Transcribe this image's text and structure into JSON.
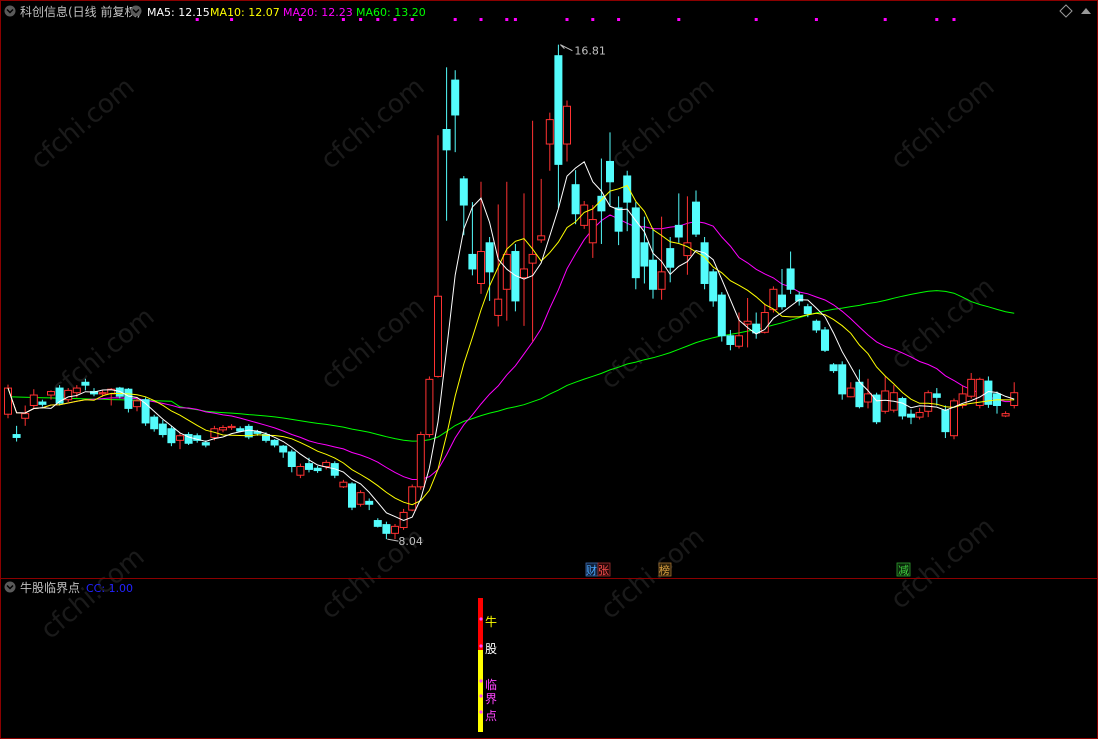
{
  "main_panel": {
    "title": "科创信息(日线 前复权)",
    "ma_labels": [
      {
        "text": "MA5: 12.15",
        "color": "#ffffff"
      },
      {
        "text": "MA10: 12.07",
        "color": "#ffff00"
      },
      {
        "text": "MA20: 12.23",
        "color": "#ff00ff"
      },
      {
        "text": "MA60: 13.20",
        "color": "#00ff00"
      }
    ],
    "high_marker": "16.81",
    "low_marker": "8.04",
    "event_tags": [
      {
        "text": "财",
        "color": "#4aa8ff"
      },
      {
        "text": "张",
        "color": "#ff5050"
      },
      {
        "text": "榜",
        "color": "#d8a040"
      },
      {
        "text": "减",
        "color": "#40d040"
      }
    ]
  },
  "indicator_panel": {
    "title": "牛股临界点",
    "value_text": "CC: 1.00",
    "signal_chars": [
      "牛",
      "股",
      "临",
      "界",
      "点"
    ]
  },
  "watermark": "cfchi.com",
  "colors": {
    "up": "#ff3232",
    "down": "#54fcfc",
    "ma5": "#ffffff",
    "ma10": "#ffff00",
    "ma20": "#ff00ff",
    "ma60": "#00ff00",
    "grid": "#8b0000"
  },
  "chart_data": {
    "type": "candlestick",
    "title": "科创信息(日线 前复权)",
    "ylim": [
      7.7,
      17.2
    ],
    "note_high": 16.81,
    "note_low": 8.04,
    "candles": [
      [
        10.45,
        10.9,
        10.38,
        10.96
      ],
      [
        10.1,
        10.05,
        9.98,
        10.25
      ],
      [
        10.38,
        10.46,
        10.25,
        10.6
      ],
      [
        10.6,
        10.78,
        10.55,
        10.88
      ],
      [
        10.66,
        10.62,
        10.58,
        10.7
      ],
      [
        10.78,
        10.84,
        10.7,
        10.86
      ],
      [
        10.9,
        10.64,
        10.6,
        10.95
      ],
      [
        10.7,
        10.86,
        10.66,
        10.9
      ],
      [
        10.82,
        10.9,
        10.74,
        10.95
      ],
      [
        11.0,
        10.95,
        10.86,
        11.06
      ],
      [
        10.84,
        10.8,
        10.76,
        10.9
      ],
      [
        10.8,
        10.82,
        10.75,
        10.86
      ],
      [
        10.8,
        10.88,
        10.6,
        10.9
      ],
      [
        10.9,
        10.76,
        10.72,
        10.92
      ],
      [
        10.88,
        10.55,
        10.48,
        10.9
      ],
      [
        10.58,
        10.68,
        10.5,
        10.74
      ],
      [
        10.7,
        10.3,
        10.25,
        10.74
      ],
      [
        10.4,
        10.2,
        10.15,
        10.44
      ],
      [
        10.28,
        10.1,
        10.05,
        10.35
      ],
      [
        10.2,
        9.96,
        9.9,
        10.25
      ],
      [
        10.0,
        10.08,
        9.85,
        10.12
      ],
      [
        10.1,
        9.95,
        9.92,
        10.14
      ],
      [
        10.08,
        10.0,
        9.96,
        10.12
      ],
      [
        9.96,
        9.92,
        9.88,
        10.0
      ],
      [
        10.05,
        10.2,
        10.0,
        10.25
      ],
      [
        10.18,
        10.22,
        10.14,
        10.26
      ],
      [
        10.22,
        10.24,
        10.18,
        10.28
      ],
      [
        10.2,
        10.16,
        10.14,
        10.24
      ],
      [
        10.24,
        10.06,
        10.02,
        10.28
      ],
      [
        10.15,
        10.12,
        10.08,
        10.18
      ],
      [
        10.1,
        10.0,
        9.96,
        10.14
      ],
      [
        10.0,
        9.92,
        9.88,
        10.02
      ],
      [
        9.9,
        9.8,
        9.7,
        9.92
      ],
      [
        9.8,
        9.55,
        9.45,
        9.84
      ],
      [
        9.4,
        9.55,
        9.35,
        9.6
      ],
      [
        9.6,
        9.5,
        9.45,
        9.7
      ],
      [
        9.52,
        9.48,
        9.44,
        9.56
      ],
      [
        9.55,
        9.62,
        9.5,
        9.66
      ],
      [
        9.6,
        9.4,
        9.35,
        9.64
      ],
      [
        9.2,
        9.28,
        9.18,
        9.32
      ],
      [
        9.25,
        8.85,
        8.8,
        9.28
      ],
      [
        8.9,
        9.1,
        8.86,
        9.14
      ],
      [
        8.95,
        8.9,
        8.8,
        9.0
      ],
      [
        8.62,
        8.52,
        8.5,
        8.66
      ],
      [
        8.55,
        8.4,
        8.3,
        8.6
      ],
      [
        8.4,
        8.52,
        8.3,
        8.56
      ],
      [
        8.5,
        8.76,
        8.46,
        8.82
      ],
      [
        8.8,
        9.2,
        8.78,
        9.24
      ],
      [
        9.2,
        10.1,
        9.15,
        10.15
      ],
      [
        10.1,
        11.05,
        10.05,
        11.1
      ],
      [
        11.1,
        12.48,
        11.08,
        15.25
      ],
      [
        15.35,
        15.0,
        13.78,
        16.42
      ],
      [
        16.2,
        15.6,
        14.96,
        16.37
      ],
      [
        14.5,
        14.05,
        13.53,
        14.55
      ],
      [
        13.2,
        12.95,
        12.84,
        14.1
      ],
      [
        12.7,
        13.25,
        12.52,
        14.45
      ],
      [
        13.4,
        12.9,
        12.4,
        13.5
      ],
      [
        12.15,
        12.43,
        11.96,
        14.06
      ],
      [
        12.6,
        13.2,
        12.06,
        14.45
      ],
      [
        13.25,
        12.4,
        12.22,
        13.38
      ],
      [
        12.8,
        12.95,
        11.97,
        14.25
      ],
      [
        13.05,
        13.2,
        11.7,
        15.5
      ],
      [
        13.45,
        13.52,
        13.4,
        14.5
      ],
      [
        15.1,
        15.52,
        14.64,
        15.64
      ],
      [
        16.62,
        14.75,
        14.0,
        16.81
      ],
      [
        15.1,
        15.75,
        14.8,
        15.85
      ],
      [
        14.4,
        13.9,
        13.72,
        14.65
      ],
      [
        13.7,
        14.05,
        13.64,
        14.12
      ],
      [
        13.4,
        13.8,
        13.14,
        14.05
      ],
      [
        14.2,
        13.95,
        13.38,
        14.85
      ],
      [
        14.8,
        14.45,
        14.02,
        15.3
      ],
      [
        14.0,
        13.6,
        13.36,
        14.2
      ],
      [
        14.55,
        14.1,
        13.6,
        14.64
      ],
      [
        14.0,
        12.8,
        12.6,
        14.1
      ],
      [
        13.4,
        13.0,
        12.7,
        13.85
      ],
      [
        13.1,
        12.6,
        12.44,
        13.65
      ],
      [
        12.6,
        12.9,
        12.42,
        13.85
      ],
      [
        13.3,
        12.98,
        12.72,
        13.5
      ],
      [
        13.7,
        13.5,
        13.4,
        14.25
      ],
      [
        13.18,
        13.4,
        12.85,
        14.2
      ],
      [
        14.1,
        13.55,
        13.5,
        14.3
      ],
      [
        13.4,
        12.7,
        12.6,
        13.5
      ],
      [
        12.9,
        12.4,
        12.3,
        12.95
      ],
      [
        12.5,
        11.8,
        11.7,
        12.55
      ],
      [
        11.8,
        11.65,
        11.55,
        11.9
      ],
      [
        11.62,
        11.8,
        11.58,
        12.2
      ],
      [
        12.0,
        12.05,
        11.6,
        12.45
      ],
      [
        12.0,
        11.85,
        11.75,
        12.2
      ],
      [
        11.86,
        12.2,
        11.84,
        12.35
      ],
      [
        12.25,
        12.6,
        12.2,
        12.65
      ],
      [
        12.5,
        12.3,
        12.25,
        12.95
      ],
      [
        12.95,
        12.6,
        12.52,
        13.25
      ],
      [
        12.5,
        12.4,
        12.32,
        12.56
      ],
      [
        12.3,
        12.18,
        12.12,
        12.35
      ],
      [
        12.05,
        11.9,
        11.85,
        12.08
      ],
      [
        11.9,
        11.55,
        11.52,
        11.95
      ],
      [
        11.3,
        11.2,
        11.16,
        11.33
      ],
      [
        11.3,
        10.8,
        10.7,
        11.36
      ],
      [
        10.75,
        10.9,
        10.74,
        11.0
      ],
      [
        11.0,
        10.58,
        10.55,
        11.22
      ],
      [
        10.66,
        10.8,
        10.55,
        11.06
      ],
      [
        10.78,
        10.32,
        10.28,
        10.82
      ],
      [
        10.5,
        10.85,
        10.46,
        11.1
      ],
      [
        10.52,
        10.82,
        10.48,
        10.95
      ],
      [
        10.72,
        10.42,
        10.36,
        10.75
      ],
      [
        10.45,
        10.4,
        10.28,
        10.53
      ],
      [
        10.4,
        10.48,
        10.36,
        10.56
      ],
      [
        10.5,
        10.82,
        10.4,
        10.86
      ],
      [
        10.8,
        10.74,
        10.6,
        10.9
      ],
      [
        10.52,
        10.15,
        10.04,
        10.6
      ],
      [
        10.08,
        10.68,
        10.02,
        10.72
      ],
      [
        10.6,
        10.8,
        10.55,
        10.94
      ],
      [
        10.76,
        11.05,
        10.72,
        11.16
      ],
      [
        10.6,
        11.05,
        10.55,
        11.08
      ],
      [
        11.02,
        10.62,
        10.56,
        11.1
      ],
      [
        10.8,
        10.6,
        10.46,
        10.84
      ],
      [
        10.42,
        10.46,
        10.4,
        10.5
      ],
      [
        10.6,
        10.82,
        10.55,
        11.0
      ]
    ]
  }
}
